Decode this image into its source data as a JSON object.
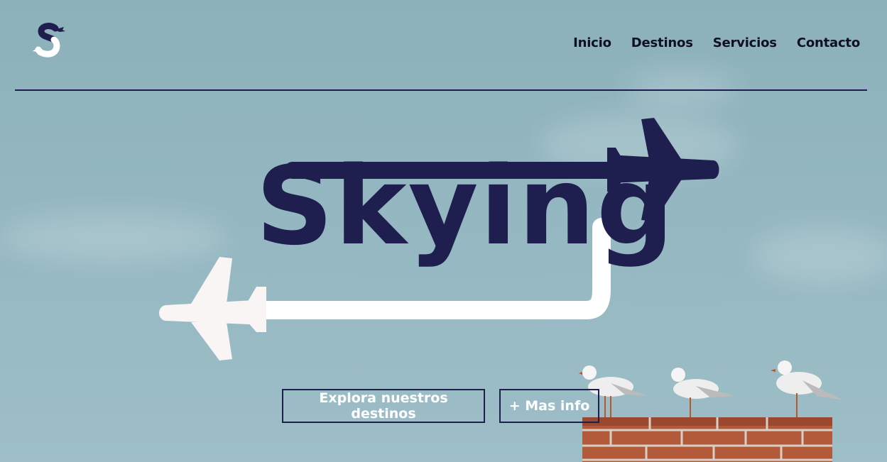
{
  "brand": {
    "name": "Skying",
    "logo_icon": "skying-logo-icon"
  },
  "nav": {
    "items": [
      {
        "label": "Inicio"
      },
      {
        "label": "Destinos"
      },
      {
        "label": "Servicios"
      },
      {
        "label": "Contacto"
      }
    ]
  },
  "hero": {
    "primary_cta": "Explora nuestros destinos",
    "secondary_cta": "+ Mas info"
  },
  "colors": {
    "navy": "#1e1f4f",
    "sky": "#8cb1bb",
    "white": "#ffffff"
  }
}
